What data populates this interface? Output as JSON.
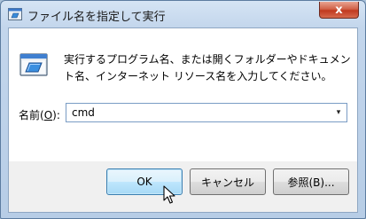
{
  "window": {
    "title": "ファイル名を指定して実行",
    "close_glyph": "x"
  },
  "dialog": {
    "description": "実行するプログラム名、または開くフォルダーやドキュメント名、インターネット リソース名を入力してください。",
    "open_label_prefix": "名前(",
    "open_label_accel": "O",
    "open_label_suffix": "):",
    "open_value": "cmd",
    "dropdown_glyph": "▾"
  },
  "buttons": {
    "ok": "OK",
    "cancel": "キャンセル",
    "browse": "参照(B)..."
  },
  "icons": {
    "title_icon": "run-icon",
    "dialog_icon": "run-icon",
    "cursor": "arrow-cursor-icon"
  },
  "colors": {
    "accent": "#3c7fb1",
    "title_bar": "#c3d6ec",
    "close_button": "#c0391f"
  }
}
